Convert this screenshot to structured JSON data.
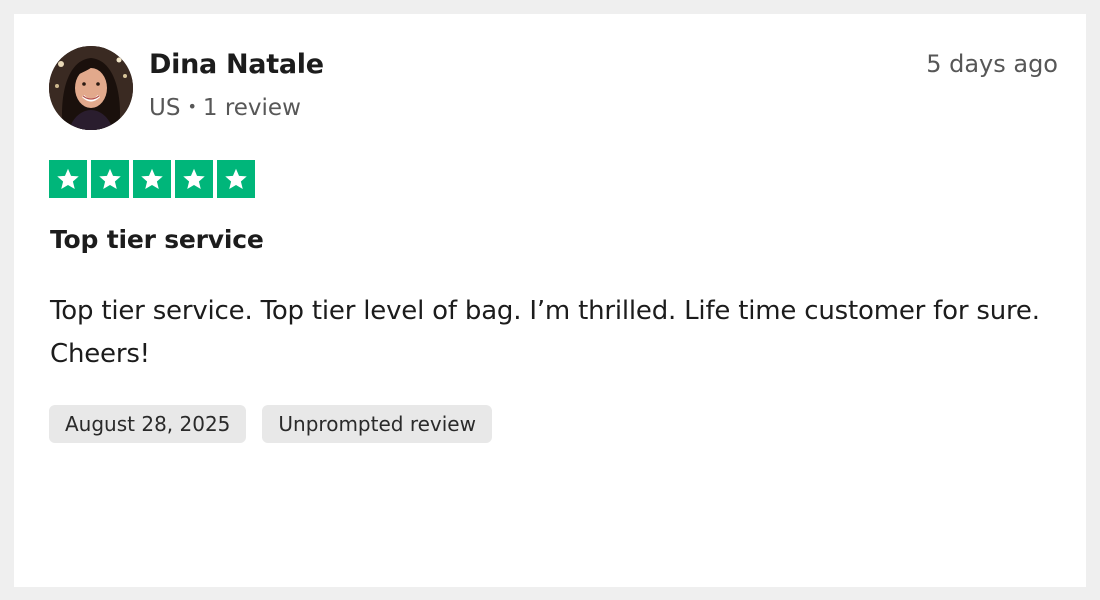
{
  "reviewer": {
    "name": "Dina Natale",
    "country": "US",
    "separator": "•",
    "review_count": "1 review"
  },
  "relative_time": "5 days ago",
  "rating": {
    "value": 5,
    "max": 5,
    "star_color": "#00b67a",
    "star_icon": "star-icon"
  },
  "review": {
    "title": "Top tier service",
    "body": "Top tier service. Top tier level of bag. I’m thrilled. Life time customer for sure. Cheers!"
  },
  "tags": {
    "date": "August 28, 2025",
    "type": "Unprompted review"
  }
}
